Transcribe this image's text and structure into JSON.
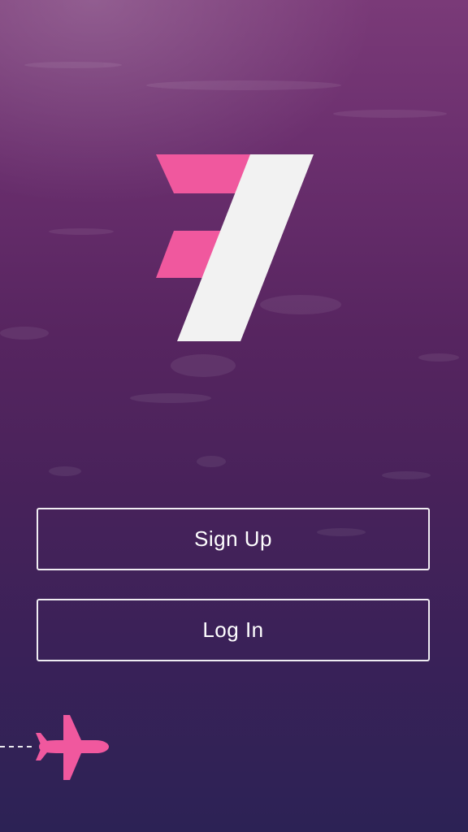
{
  "buttons": {
    "signup_label": "Sign Up",
    "login_label": "Log In"
  },
  "icons": {
    "logo": "brand-logo-seven",
    "plane": "airplane-icon"
  },
  "colors": {
    "brand_pink": "#f0589e",
    "logo_white": "#f2f2f2",
    "button_border": "#ffffff"
  }
}
